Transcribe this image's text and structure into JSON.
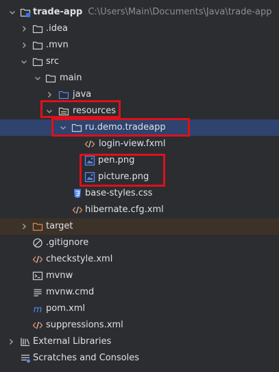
{
  "project": {
    "name": "trade-app",
    "path": "C:\\Users\\Main\\Documents\\Java\\trade-app"
  },
  "items": [
    {
      "label": ".idea",
      "icon": "folder-icon",
      "expand": "collapsed"
    },
    {
      "label": ".mvn",
      "icon": "folder-icon",
      "expand": "collapsed"
    },
    {
      "label": "src",
      "icon": "folder-icon",
      "expand": "expanded"
    },
    {
      "label": "main",
      "icon": "folder-icon",
      "expand": "expanded"
    },
    {
      "label": "java",
      "icon": "source-folder-icon",
      "expand": "collapsed"
    },
    {
      "label": "resources",
      "icon": "resources-folder-icon",
      "expand": "expanded"
    },
    {
      "label": "ru.demo.tradeapp",
      "icon": "package-folder-icon",
      "expand": "expanded",
      "selected": true
    },
    {
      "label": "login-view.fxml",
      "icon": "xml-icon",
      "expand": "none"
    },
    {
      "label": "pen.png",
      "icon": "image-icon",
      "expand": "none"
    },
    {
      "label": "picture.png",
      "icon": "image-icon",
      "expand": "none"
    },
    {
      "label": "base-styles.css",
      "icon": "css-icon",
      "expand": "none"
    },
    {
      "label": "hibernate.cfg.xml",
      "icon": "xml-icon",
      "expand": "none"
    },
    {
      "label": "target",
      "icon": "excluded-folder-icon",
      "expand": "collapsed",
      "excluded": true
    },
    {
      "label": ".gitignore",
      "icon": "gitignore-icon",
      "expand": "none"
    },
    {
      "label": "checkstyle.xml",
      "icon": "xml-icon",
      "expand": "none"
    },
    {
      "label": "mvnw",
      "icon": "terminal-icon",
      "expand": "none"
    },
    {
      "label": "mvnw.cmd",
      "icon": "text-file-icon",
      "expand": "none"
    },
    {
      "label": "pom.xml",
      "icon": "maven-icon",
      "expand": "none"
    },
    {
      "label": "suppressions.xml",
      "icon": "xml-icon",
      "expand": "none"
    },
    {
      "label": "External Libraries",
      "icon": "libraries-icon",
      "expand": "collapsed"
    },
    {
      "label": "Scratches and Consoles",
      "icon": "scratches-icon",
      "expand": "none"
    }
  ],
  "colors": {
    "background": "#2b2d30",
    "selection": "#2e436e",
    "excluded_row": "#3c3228",
    "highlight_border": "#e0101a",
    "text": "#dfe1e5",
    "path_text": "#8c8f94"
  }
}
